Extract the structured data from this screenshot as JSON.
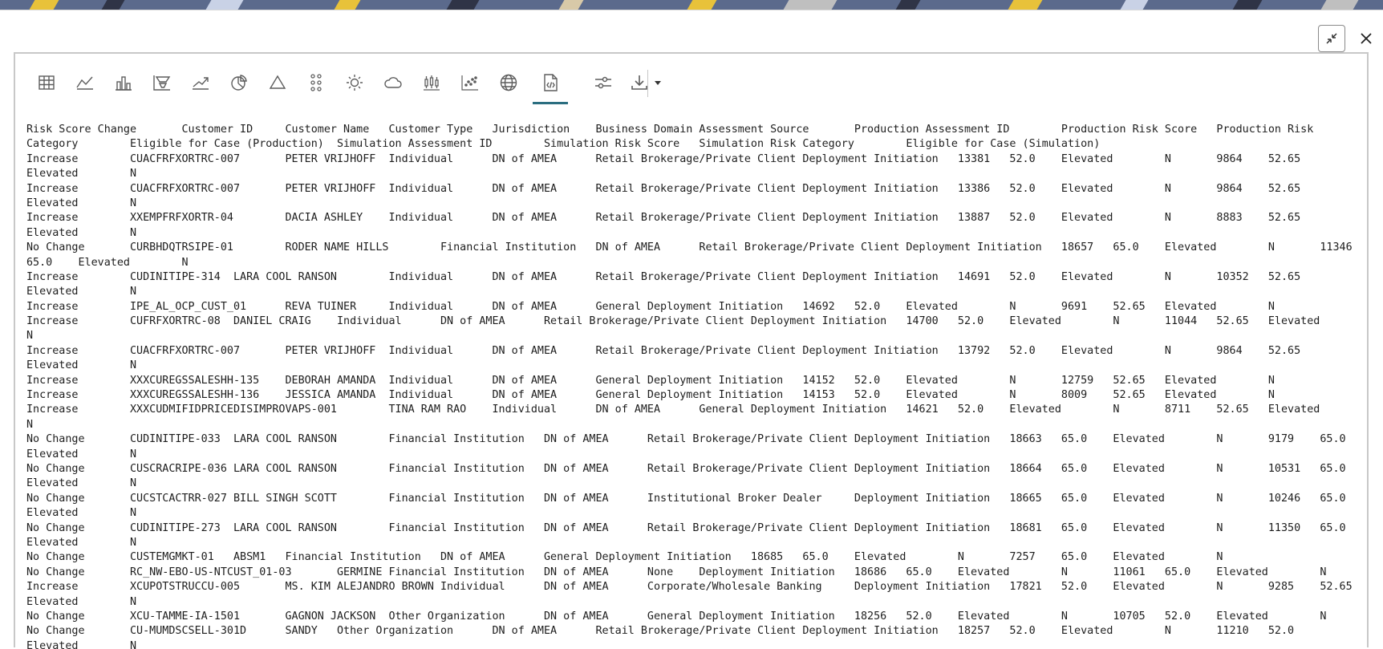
{
  "toolbar": {
    "icons": [
      "table-icon",
      "line-chart-icon",
      "bar-chart-icon",
      "funnel-chart-icon",
      "trend-line-icon",
      "pie-chart-icon",
      "triangle-icon",
      "dot-matrix-icon",
      "sun-icon",
      "cloud-icon",
      "box-plot-icon",
      "scatter-icon",
      "globe-icon",
      "code-file-icon",
      "settings-sliders-icon",
      "download-icon"
    ],
    "active": "code-file-icon"
  },
  "accent_color": "#2b6e80",
  "report_lines": [
    "Risk Score Change       Customer ID     Customer Name   Customer Type   Jurisdiction    Business Domain Assessment Source       Production Assessment ID        Production Risk Score   Production Risk",
    "Category        Eligible for Case (Production)  Simulation Assessment ID        Simulation Risk Score   Simulation Risk Category        Eligible for Case (Simulation)",
    "Increase        CUACFRFXORTRC-007       PETER VRIJHOFF  Individual      DN of AMEA      Retail Brokerage/Private Client Deployment Initiation   13381   52.0    Elevated        N       9864    52.65",
    "Elevated        N",
    "Increase        CUACFRFXORTRC-007       PETER VRIJHOFF  Individual      DN of AMEA      Retail Brokerage/Private Client Deployment Initiation   13386   52.0    Elevated        N       9864    52.65",
    "Elevated        N",
    "Increase        XXEMPFRFXORTR-04        DACIA ASHLEY    Individual      DN of AMEA      Retail Brokerage/Private Client Deployment Initiation   13887   52.0    Elevated        N       8883    52.65",
    "Elevated        N",
    "No Change       CURBHDQTRSIPE-01        RODER NAME HILLS        Financial Institution   DN of AMEA      Retail Brokerage/Private Client Deployment Initiation   18657   65.0    Elevated        N       11346",
    "65.0    Elevated        N",
    "Increase        CUDINITIPE-314  LARA COOL RANSON        Individual      DN of AMEA      Retail Brokerage/Private Client Deployment Initiation   14691   52.0    Elevated        N       10352   52.65",
    "Elevated        N",
    "Increase        IPE_AL_OCP_CUST_01      REVA TUINER     Individual      DN of AMEA      General Deployment Initiation   14692   52.0    Elevated        N       9691    52.65   Elevated        N",
    "Increase        CUFRFXORTRC-08  DANIEL CRAIG    Individual      DN of AMEA      Retail Brokerage/Private Client Deployment Initiation   14700   52.0    Elevated        N       11044   52.65   Elevated",
    "N",
    "Increase        CUACFRFXORTRC-007       PETER VRIJHOFF  Individual      DN of AMEA      Retail Brokerage/Private Client Deployment Initiation   13792   52.0    Elevated        N       9864    52.65",
    "Elevated        N",
    "Increase        XXXCUREGSSALESHH-135    DEBORAH AMANDA  Individual      DN of AMEA      General Deployment Initiation   14152   52.0    Elevated        N       12759   52.65   Elevated        N",
    "Increase        XXXCUREGSSALESHH-136    JESSICA AMANDA  Individual      DN of AMEA      General Deployment Initiation   14153   52.0    Elevated        N       8009    52.65   Elevated        N",
    "Increase        XXXCUDMIFIDPRICEDISIMPROVAPS-001        TINA RAM RAO    Individual      DN of AMEA      General Deployment Initiation   14621   52.0    Elevated        N       8711    52.65   Elevated",
    "N",
    "No Change       CUDINITIPE-033  LARA COOL RANSON        Financial Institution   DN of AMEA      Retail Brokerage/Private Client Deployment Initiation   18663   65.0    Elevated        N       9179    65.0",
    "Elevated        N",
    "No Change       CUSCRACRIPE-036 LARA COOL RANSON        Financial Institution   DN of AMEA      Retail Brokerage/Private Client Deployment Initiation   18664   65.0    Elevated        N       10531   65.0",
    "Elevated        N",
    "No Change       CUCSTCACTRR-027 BILL SINGH SCOTT        Financial Institution   DN of AMEA      Institutional Broker Dealer     Deployment Initiation   18665   65.0    Elevated        N       10246   65.0",
    "Elevated        N",
    "No Change       CUDINITIPE-273  LARA COOL RANSON        Financial Institution   DN of AMEA      Retail Brokerage/Private Client Deployment Initiation   18681   65.0    Elevated        N       11350   65.0",
    "Elevated        N",
    "No Change       CUSTEMGMKT-01   ABSM1   Financial Institution   DN of AMEA      General Deployment Initiation   18685   65.0    Elevated        N       7257    65.0    Elevated        N",
    "No Change       RC_NW-EBO-US-NTCUST_01-03       GERMINE Financial Institution   DN of AMEA      None    Deployment Initiation   18686   65.0    Elevated        N       11061   65.0    Elevated        N",
    "Increase        XCUPOTSTRUCCU-005       MS. KIM ALEJANDRO BROWN Individual      DN of AMEA      Corporate/Wholesale Banking     Deployment Initiation   17821   52.0    Elevated        N       9285    52.65",
    "Elevated        N",
    "No Change       XCU-TAMME-IA-1501       GAGNON JACKSON  Other Organization      DN of AMEA      General Deployment Initiation   18256   52.0    Elevated        N       10705   52.0    Elevated        N",
    "No Change       CU-MUMDSCSELL-301D      SANDY   Other Organization      DN of AMEA      Retail Brokerage/Private Client Deployment Initiation   18257   52.0    Elevated        N       11210   52.0",
    "Elevated        N"
  ]
}
